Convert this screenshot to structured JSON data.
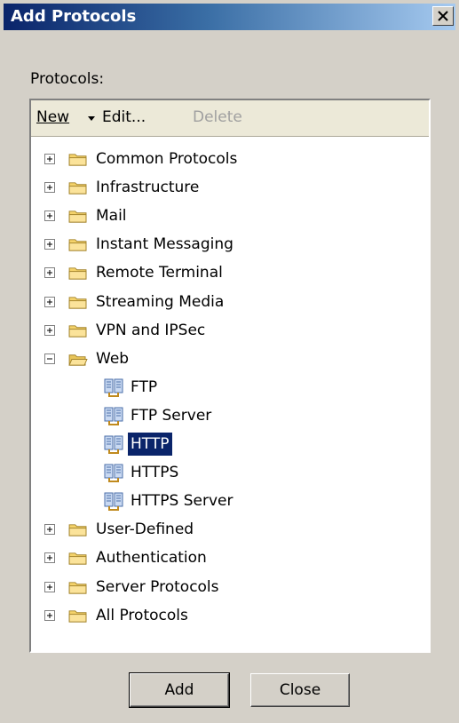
{
  "window": {
    "title": "Add Protocols",
    "close_glyph": "✕"
  },
  "protocols_label": "Protocols:",
  "toolbar": {
    "new_label": "New",
    "edit_label": "Edit...",
    "delete_label": "Delete"
  },
  "tree": [
    {
      "label": "Common Protocols",
      "type": "folder",
      "expanded": false
    },
    {
      "label": "Infrastructure",
      "type": "folder",
      "expanded": false
    },
    {
      "label": "Mail",
      "type": "folder",
      "expanded": false
    },
    {
      "label": "Instant Messaging",
      "type": "folder",
      "expanded": false
    },
    {
      "label": "Remote Terminal",
      "type": "folder",
      "expanded": false
    },
    {
      "label": "Streaming Media",
      "type": "folder",
      "expanded": false
    },
    {
      "label": "VPN and IPSec",
      "type": "folder",
      "expanded": false
    },
    {
      "label": "Web",
      "type": "folder",
      "expanded": true
    },
    {
      "label": "FTP",
      "type": "protocol"
    },
    {
      "label": "FTP Server",
      "type": "protocol"
    },
    {
      "label": "HTTP",
      "type": "protocol",
      "selected": true
    },
    {
      "label": "HTTPS",
      "type": "protocol"
    },
    {
      "label": "HTTPS Server",
      "type": "protocol"
    },
    {
      "label": "User-Defined",
      "type": "folder",
      "expanded": false
    },
    {
      "label": "Authentication",
      "type": "folder",
      "expanded": false
    },
    {
      "label": "Server Protocols",
      "type": "folder",
      "expanded": false
    },
    {
      "label": "All Protocols",
      "type": "folder",
      "expanded": false
    }
  ],
  "buttons": {
    "add_label": "Add",
    "close_label": "Close"
  },
  "colors": {
    "titlebar_start": "#0a246a",
    "titlebar_end": "#a6caf0",
    "selection": "#0a246a",
    "folder": "#f5d36b"
  }
}
